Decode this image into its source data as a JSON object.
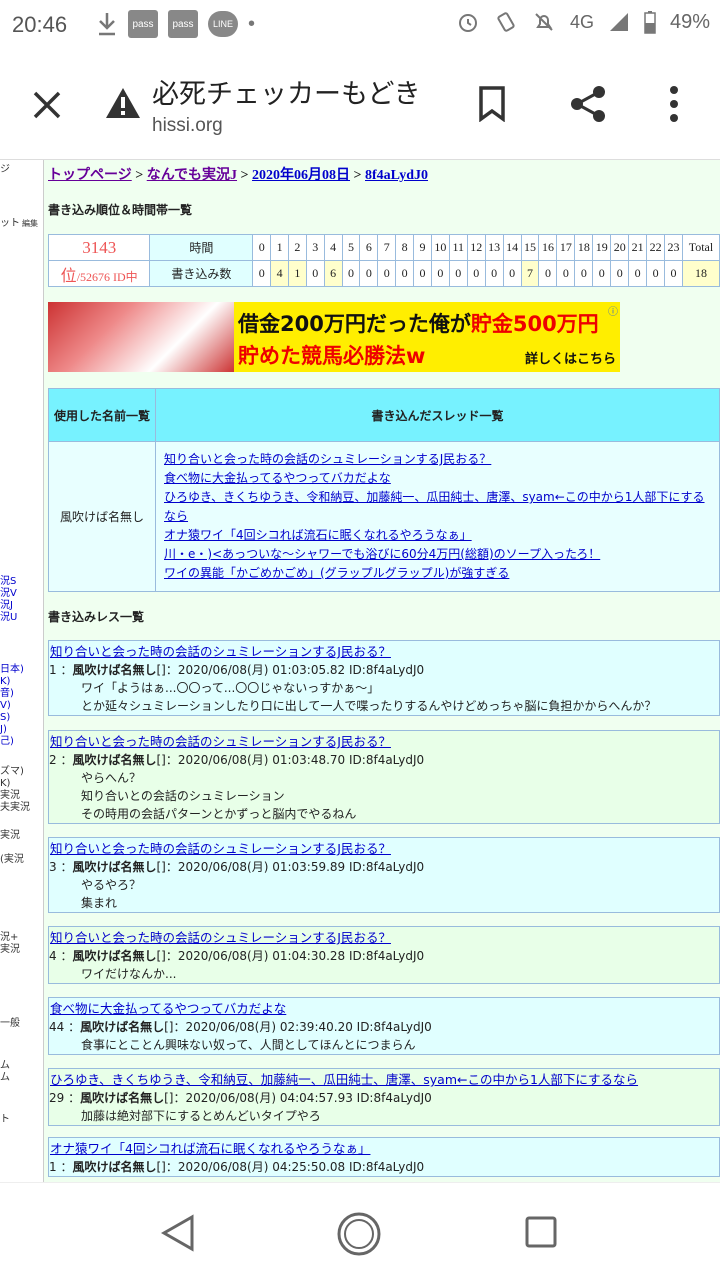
{
  "status_bar": {
    "time": "20:46",
    "notif_pass1": "pass",
    "notif_pass2": "pass",
    "notif_line": "LINE",
    "network": "4G",
    "battery": "49%"
  },
  "toolbar": {
    "title": "必死チェッカーもどき",
    "url": "hissi.org"
  },
  "breadcrumb": {
    "top": "トップページ",
    "sep1": ">",
    "board": "なんでも実況J",
    "sep2": ">",
    "date": "2020年06月08日",
    "sep3": ">",
    "id": "8f4aLydJ0"
  },
  "rank_section": {
    "heading": "書き込み順位＆時間帯一覧",
    "rank": "3143",
    "rank_unit": "位",
    "total_ids": "/52676 ID中",
    "time_label": "時間",
    "count_label": "書き込み数",
    "hours": [
      "0",
      "1",
      "2",
      "3",
      "4",
      "5",
      "6",
      "7",
      "8",
      "9",
      "10",
      "11",
      "12",
      "13",
      "14",
      "15",
      "16",
      "17",
      "18",
      "19",
      "20",
      "21",
      "22",
      "23"
    ],
    "counts": [
      "0",
      "4",
      "1",
      "0",
      "6",
      "0",
      "0",
      "0",
      "0",
      "0",
      "0",
      "0",
      "0",
      "0",
      "0",
      "7",
      "0",
      "0",
      "0",
      "0",
      "0",
      "0",
      "0",
      "0"
    ],
    "total_label": "Total",
    "total": "18"
  },
  "banner": {
    "line1_a": "借金200万円だった俺が",
    "line1_b": "貯金500万円",
    "line2": "貯めた競馬必勝法w",
    "cta": "詳しくはこちら",
    "info": "ⓘ"
  },
  "names_table": {
    "col1": "使用した名前一覧",
    "col2": "書き込んだスレッド一覧",
    "name": "風吹けば名無し",
    "threads": [
      "知り合いと会った時の会話のシュミレーションするJ民おる？",
      "食べ物に大金払ってるやつってバカだよな",
      "ひろゆき、きくちゆうき、令和納豆、加藤純一、瓜田純士、唐澤、syam←この中から1人部下にするなら",
      "オナ猿ワイ「4回シコれば流石に眠くなれるやろうなぁ」",
      "川・e・)<あっついな〜シャワーでも浴びに60分4万円(総額)のソープ入ったろ！",
      "ワイの異能「かごめかごめ」(グラップルグラップル)が強すぎる"
    ]
  },
  "posts_section": {
    "heading": "書き込みレス一覧",
    "posts": [
      {
        "thread": "知り合いと会った時の会話のシュミレーションするJ民おる？",
        "num": "1",
        "name": "風吹けば名無し",
        "bracket": "[]",
        "date": "2020/06/08(月) 01:03:05.82 ID:8f4aLydJ0",
        "lines": [
          "ワイ「ようはぁ...〇〇って...〇〇じゃないっすかぁ〜」",
          "とか延々シュミレーションしたり口に出して一人で喋ったりするんやけどめっちゃ脳に負担かからへんか？"
        ]
      },
      {
        "thread": "知り合いと会った時の会話のシュミレーションするJ民おる？",
        "num": "2",
        "name": "風吹けば名無し",
        "bracket": "[]",
        "date": "2020/06/08(月) 01:03:48.70 ID:8f4aLydJ0",
        "lines": [
          "やらへん？",
          "知り合いとの会話のシュミレーション",
          "その時用の会話パターンとかずっと脳内でやるねん"
        ]
      },
      {
        "thread": "知り合いと会った時の会話のシュミレーションするJ民おる？",
        "num": "3",
        "name": "風吹けば名無し",
        "bracket": "[]",
        "date": "2020/06/08(月) 01:03:59.89 ID:8f4aLydJ0",
        "lines": [
          "やるやろ？",
          "集まれ"
        ]
      },
      {
        "thread": "知り合いと会った時の会話のシュミレーションするJ民おる？",
        "num": "4",
        "name": "風吹けば名無し",
        "bracket": "[]",
        "date": "2020/06/08(月) 01:04:30.28 ID:8f4aLydJ0",
        "lines": [
          "ワイだけなんか..."
        ]
      },
      {
        "thread": "食べ物に大金払ってるやつってバカだよな",
        "num": "44",
        "name": "風吹けば名無し",
        "bracket": "[]",
        "date": "2020/06/08(月) 02:39:40.20 ID:8f4aLydJ0",
        "lines": [
          "食事にとことん興味ない奴って、人間としてほんとにつまらん"
        ]
      },
      {
        "thread": "ひろゆき、きくちゆうき、令和納豆、加藤純一、瓜田純士、唐澤、syam←この中から1人部下にするなら",
        "num": "29",
        "name": "風吹けば名無し",
        "bracket": "[]",
        "date": "2020/06/08(月) 04:04:57.93 ID:8f4aLydJ0",
        "lines": [
          "加藤は絶対部下にするとめんどいタイプやろ"
        ]
      },
      {
        "thread": "オナ猿ワイ「4回シコれば流石に眠くなれるやろうなぁ」",
        "num": "1",
        "name": "風吹けば名無し",
        "bracket": "[]",
        "date": "2020/06/08(月) 04:25:50.08 ID:8f4aLydJ0",
        "lines": []
      }
    ]
  },
  "left_strip": [
    "ジ",
    "ット",
    "編集",
    "況S",
    "況V",
    "況J",
    "況U",
    "日本)",
    "K)",
    "音)",
    "V)",
    "S)",
    "J)",
    "己)",
    "ズマ)",
    "K)",
    "実況",
    "夫実況",
    "実況",
    "(実況",
    "況+",
    "実況",
    "一般",
    "ム",
    "ム",
    "ト"
  ],
  "colors": {
    "link": "#0000cc",
    "visited": "#660099",
    "header_cyan": "#77f2ff",
    "page_bg": "#f0fff0",
    "banner_yellow": "#ffee00",
    "rank_red": "#ee5555"
  }
}
